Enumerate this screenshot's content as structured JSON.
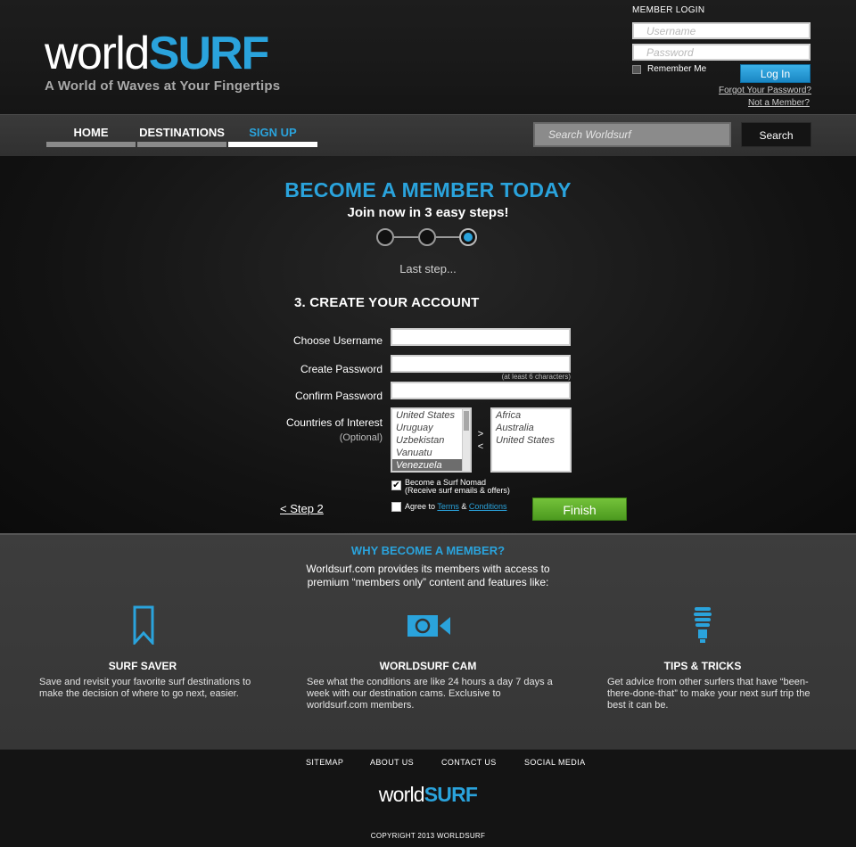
{
  "header": {
    "logo": {
      "part1": "world",
      "part2": "SURF"
    },
    "tagline": "A World of Waves at Your Fingertips"
  },
  "login": {
    "title": "MEMBER LOGIN",
    "username_placeholder": "Username",
    "password_placeholder": "Password",
    "remember_label": "Remember Me",
    "login_button": "Log In",
    "forgot_link": "Forgot Your Password?",
    "not_member_link": "Not a Member?"
  },
  "nav": {
    "items": [
      {
        "label": "HOME"
      },
      {
        "label": "DESTINATIONS"
      },
      {
        "label": "SIGN UP"
      }
    ],
    "search_placeholder": "Search Worldsurf",
    "search_button": "Search"
  },
  "signup": {
    "headline": "BECOME A MEMBER TODAY",
    "subheadline": "Join now in 3 easy steps!",
    "step_total": 3,
    "step_current": 3,
    "step_caption": "Last step...",
    "section_title": "3. CREATE YOUR ACCOUNT",
    "fields": {
      "username_label": "Choose Username",
      "password_label": "Create Password",
      "password_hint": "(at least 6 characters)",
      "confirm_label": "Confirm Password",
      "countries_label": "Countries of Interest",
      "countries_optional": "(Optional)"
    },
    "available_countries": [
      "United States",
      "Uruguay",
      "Uzbekistan",
      "Vanuatu",
      "Venezuela"
    ],
    "selected_available": "Venezuela",
    "chosen_countries": [
      "Africa",
      "Australia",
      "United States"
    ],
    "add_arrow": ">",
    "remove_arrow": "<",
    "nomad_line1": "Become a Surf Nomad",
    "nomad_line2": "(Receive surf emails & offers)",
    "nomad_checked": true,
    "agree_prefix": "Agree to",
    "terms_link": "Terms",
    "agree_amp": "&",
    "conditions_link": "Conditions",
    "agree_checked": false,
    "back_link": "< Step 2",
    "finish_button": "Finish"
  },
  "why": {
    "title": "WHY BECOME A MEMBER?",
    "intro": "Worldsurf.com provides its members with access to premium “members only” content and features like:",
    "features": [
      {
        "icon": "bookmark-icon",
        "title": "SURF SAVER",
        "desc": "Save and revisit your favorite surf destinations to make the decision of where to go next, easier."
      },
      {
        "icon": "video-camera-icon",
        "title": "WORLDSURF CAM",
        "desc": "See what the conditions are like 24 hours a day 7 days a week with our destination cams. Exclusive to worldsurf.com members."
      },
      {
        "icon": "lightbulb-icon",
        "title": "TIPS & TRICKS",
        "desc": "Get advice from other surfers that have “been-there-done-that” to make your next surf trip the best it can be."
      }
    ]
  },
  "footer": {
    "links": [
      {
        "label": "SITEMAP"
      },
      {
        "label": "ABOUT US"
      },
      {
        "label": "CONTACT US"
      },
      {
        "label": "SOCIAL MEDIA"
      }
    ],
    "logo": {
      "part1": "world",
      "part2": "SURF"
    },
    "copyright": "COPYRIGHT 2013 WORLDSURF"
  },
  "colors": {
    "accent": "#2aa3dc",
    "finish_green": "#5fae2b",
    "background": "#111111"
  }
}
